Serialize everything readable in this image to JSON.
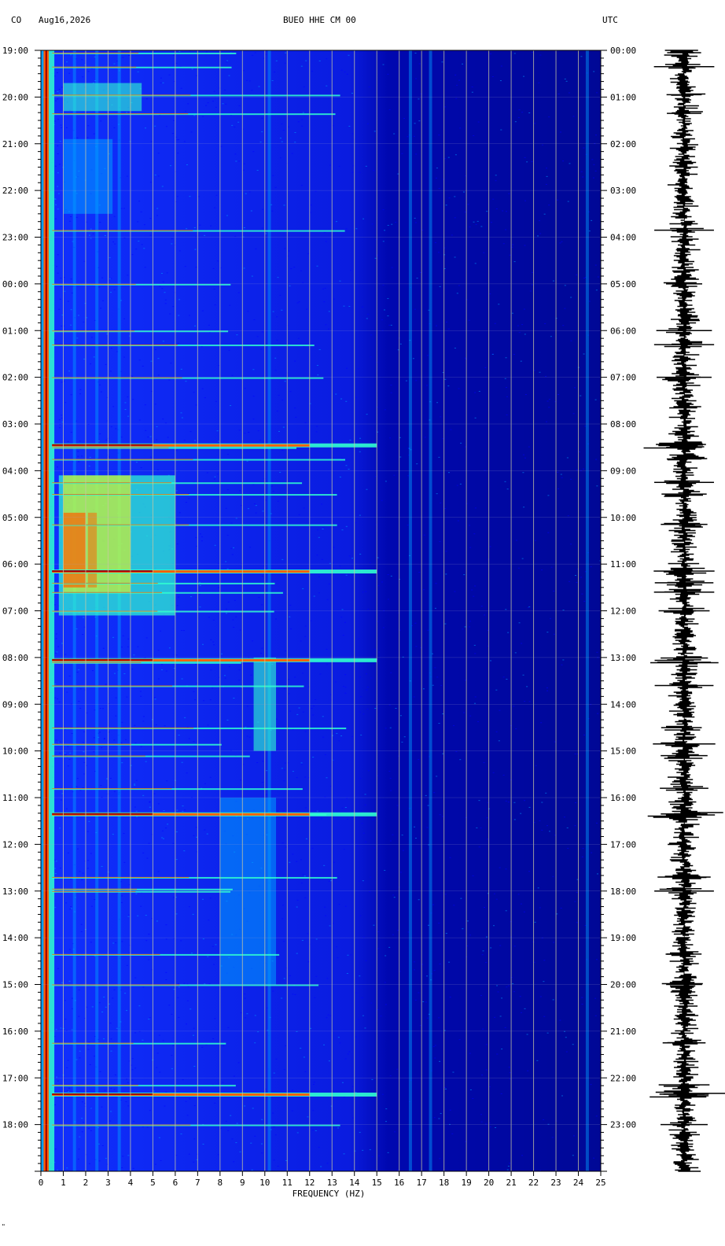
{
  "header": {
    "network": "CO",
    "date": "Aug16,2026",
    "station": "BUEO HHE CM 00",
    "timezone": "UTC"
  },
  "footer_mark": "\"",
  "chart_data": {
    "type": "heatmap",
    "title": "BUEO HHE CM 00",
    "xlabel": "FREQUENCY (HZ)",
    "xlim": [
      0,
      25
    ],
    "x_ticks": [
      "0",
      "1",
      "2",
      "3",
      "4",
      "5",
      "6",
      "7",
      "8",
      "9",
      "10",
      "11",
      "12",
      "13",
      "14",
      "15",
      "16",
      "17",
      "18",
      "19",
      "20",
      "21",
      "22",
      "23",
      "24",
      "25"
    ],
    "left_time_ticks": [
      "19:00",
      "20:00",
      "21:00",
      "22:00",
      "23:00",
      "00:00",
      "01:00",
      "02:00",
      "03:00",
      "04:00",
      "05:00",
      "06:00",
      "07:00",
      "08:00",
      "09:00",
      "10:00",
      "11:00",
      "12:00",
      "13:00",
      "14:00",
      "15:00",
      "16:00",
      "17:00",
      "18:00"
    ],
    "right_time_ticks": [
      "00:00",
      "01:00",
      "02:00",
      "03:00",
      "04:00",
      "05:00",
      "06:00",
      "07:00",
      "08:00",
      "09:00",
      "10:00",
      "11:00",
      "12:00",
      "13:00",
      "14:00",
      "15:00",
      "16:00",
      "17:00",
      "18:00",
      "19:00",
      "20:00",
      "21:00",
      "22:00",
      "23:00"
    ],
    "duration_hours": 24,
    "colormap": [
      "#00007f",
      "#0000ff",
      "#00a0ff",
      "#30ffd0",
      "#ffff00",
      "#ff6000",
      "#a00000"
    ],
    "broadband_events_hour": [
      0.05,
      0.35,
      0.95,
      1.35,
      3.85,
      5.0,
      6.0,
      6.3,
      7.0,
      8.5,
      8.75,
      9.25,
      9.5,
      10.15,
      11.4,
      11.6,
      12.0,
      13.1,
      13.6,
      14.5,
      14.85,
      15.1,
      15.8,
      16.35,
      17.7,
      17.95,
      18.0,
      19.35,
      20.0,
      21.25,
      22.15,
      22.35,
      23.0
    ],
    "strong_events_hour": [
      8.45,
      11.15,
      13.05,
      16.35,
      22.35
    ],
    "harmonic_bands_hz": [
      1.5,
      2.5,
      3.5,
      10.2,
      16.5,
      17.4,
      24.4
    ]
  }
}
